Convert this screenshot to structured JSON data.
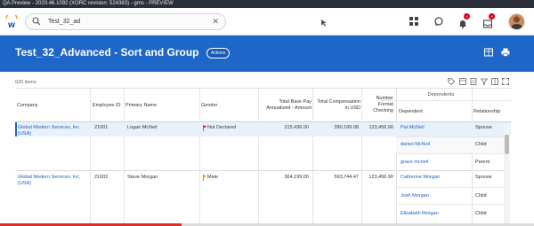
{
  "window": {
    "title": "QA Preview - 2020.46.1092 (XORC revision: 524383) - gms - PREVIEW"
  },
  "header": {
    "search_value": "Test_32_ad",
    "notifications_count": "9",
    "inbox_count": "9"
  },
  "page": {
    "title": "Test_32_Advanced - Sort and Group",
    "actions_label": "Actions",
    "items_count": "620 items"
  },
  "table": {
    "dependents_group": "Dependents",
    "columns": {
      "company": "Company",
      "employee_id": "Employee ID",
      "primary_name": "Primary Name",
      "gender": "Gender",
      "total_base_pay_1": "Total Base Pay",
      "total_base_pay_2": "Annualized - Amount",
      "total_comp_1": "Total Compensation",
      "total_comp_2": "in USD",
      "number_format_1": "Number",
      "number_format_2": "Format",
      "number_format_3": "Checking",
      "dependent": "Dependent",
      "relationship": "Relationship"
    },
    "rows": [
      {
        "company_1": "Global Modern Services, Inc.",
        "company_2": "(USA)",
        "employee_id": "21001",
        "primary_name": "Logan McNeil",
        "gender": "Not Declared",
        "total_base_pay": "215,436.00",
        "total_comp": "280,189.08",
        "number_format": "123,456.90",
        "dependents": [
          {
            "name": "Pat McNeil",
            "relationship": "Spouse"
          },
          {
            "name": "daniel McNeil",
            "relationship": "Child"
          },
          {
            "name": "grace mcneil",
            "relationship": "Parent"
          }
        ]
      },
      {
        "company_1": "Global Modern Services, Inc.",
        "company_2": "(USA)",
        "employee_id": "21002",
        "primary_name": "Steve Morgan",
        "gender": "Male",
        "total_base_pay": "364,199.00",
        "total_comp": "593,744.47",
        "number_format": "123,456.90",
        "dependents": [
          {
            "name": "Catherine Morgan",
            "relationship": "Spouse"
          },
          {
            "name": "Josh Morgan",
            "relationship": "Child"
          },
          {
            "name": "Elizabeth Morgan",
            "relationship": "Child"
          }
        ]
      }
    ]
  },
  "video_progress": 0.34,
  "colors": {
    "banner": "#1f66c9",
    "link": "#1d5fb8",
    "selected_row": "#e8f1fb",
    "progress": "#e22b2b"
  }
}
